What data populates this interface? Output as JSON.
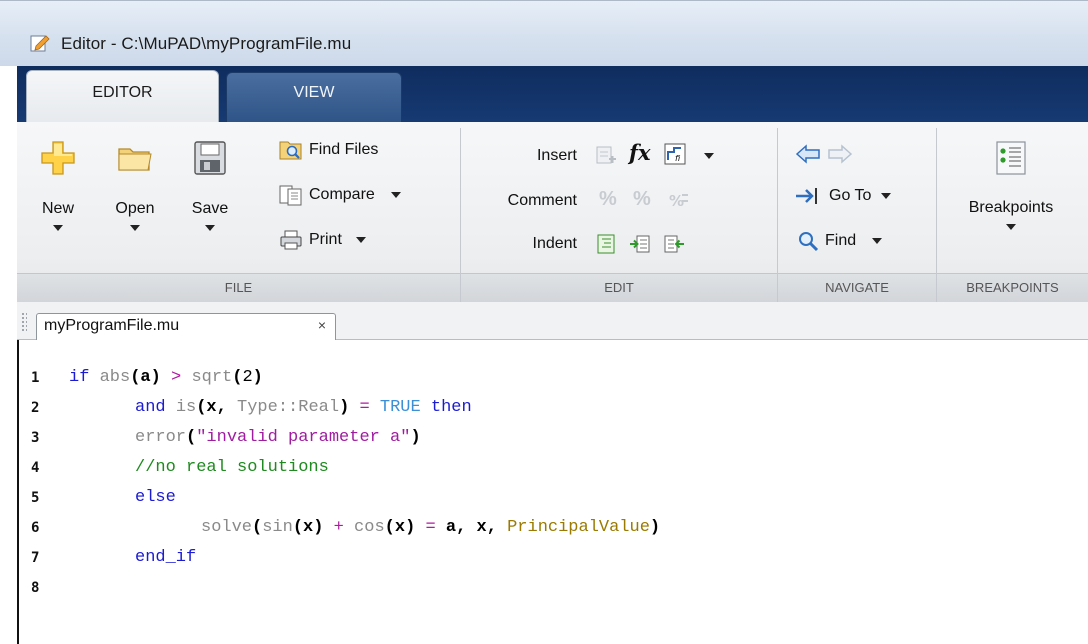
{
  "window": {
    "title": "Editor - C:\\MuPAD\\myProgramFile.mu"
  },
  "tabs": [
    {
      "label": "EDITOR",
      "active": true
    },
    {
      "label": "VIEW",
      "active": false
    }
  ],
  "ribbon": {
    "file": {
      "group_label": "FILE",
      "new_label": "New",
      "open_label": "Open",
      "save_label": "Save",
      "find_files_label": "Find Files",
      "compare_label": "Compare",
      "print_label": "Print"
    },
    "edit": {
      "group_label": "EDIT",
      "insert_label": "Insert",
      "comment_label": "Comment",
      "indent_label": "Indent",
      "fx_label": "fx"
    },
    "navigate": {
      "group_label": "NAVIGATE",
      "goto_label": "Go To",
      "find_label": "Find"
    },
    "breakpoints": {
      "group_label": "BREAKPOINTS",
      "breakpoints_label": "Breakpoints"
    }
  },
  "document": {
    "tab_label": "myProgramFile.mu",
    "close_glyph": "×"
  },
  "code": {
    "line_numbers": [
      "1",
      "2",
      "3",
      "4",
      "5",
      "6",
      "7",
      "8"
    ],
    "line1": {
      "kw_if": "if",
      "abs": "abs",
      "p1": "(",
      "a": "a",
      "p2": ")",
      "gt": ">",
      "sqrt": "sqrt",
      "p3": "(",
      "two": "2",
      "p4": ")"
    },
    "line2": {
      "kw_and": "and",
      "is": "is",
      "p1": "(",
      "x": "x",
      "comma": ",",
      "type": "Type::Real",
      "p2": ")",
      "eq": "=",
      "true": "TRUE",
      "then": "then"
    },
    "line3": {
      "error": "error",
      "p1": "(",
      "str": "\"invalid parameter a\"",
      "p2": ")"
    },
    "line4": {
      "comment": "//no real solutions"
    },
    "line5": {
      "kw_else": "else"
    },
    "line6": {
      "solve": "solve",
      "p1": "(",
      "sin": "sin",
      "p2": "(",
      "x1": "x",
      "p3": ")",
      "plus": "+",
      "cos": "cos",
      "p4": "(",
      "x2": "x",
      "p5": ")",
      "eq": "=",
      "a": "a",
      "c1": ",",
      "x3": "x",
      "c2": ",",
      "pv": "PrincipalValue",
      "p6": ")"
    },
    "line7": {
      "end_if": "end_if"
    }
  }
}
